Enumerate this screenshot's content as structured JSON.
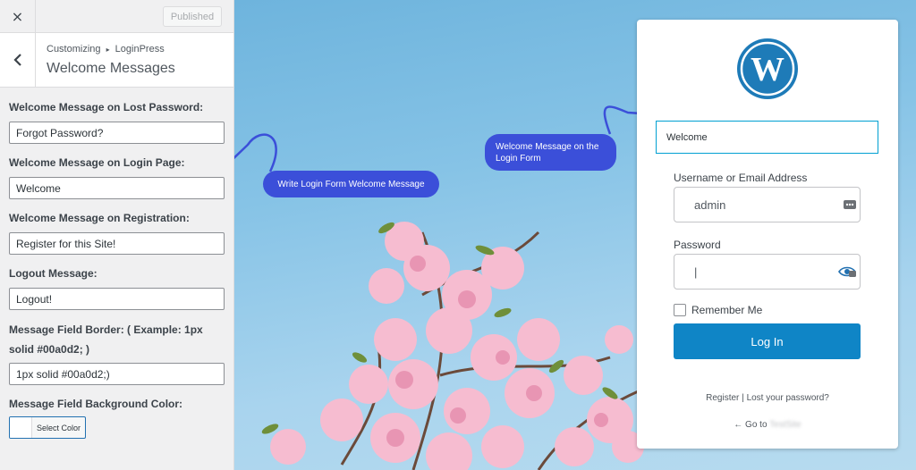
{
  "topbar": {
    "close_icon": "×",
    "publish_label": "Published"
  },
  "section": {
    "breadcrumb_root": "Customizing",
    "breadcrumb_sep": "▸",
    "breadcrumb_child": "LoginPress",
    "title": "Welcome Messages"
  },
  "controls": [
    {
      "label": "Welcome Message on Lost Password:",
      "value": "Forgot Password?"
    },
    {
      "label": "Welcome Message on Login Page:",
      "value": "Welcome"
    },
    {
      "label": "Welcome Message on Registration:",
      "value": "Register for this Site!"
    },
    {
      "label": "Logout Message:",
      "value": "Logout!"
    },
    {
      "label": "Message Field Border: ( Example: 1px solid #00a0d2; )",
      "value": "1px solid #00a0d2;)"
    }
  ],
  "bg_color": {
    "label": "Message Field Background Color:",
    "button": "Select Color"
  },
  "callouts": {
    "left": "Write Login Form Welcome Message",
    "right": "Welcome Message on the Login Form"
  },
  "login": {
    "welcome": "Welcome",
    "username_label": "Username or Email Address",
    "username_value": "admin",
    "password_label": "Password",
    "password_value": "|",
    "remember_label": "Remember Me",
    "login_button": "Log In",
    "register_link": "Register",
    "link_sep": "|",
    "lost_password_link": "Lost your password?",
    "goto_prefix": "← Go to",
    "site_name": "TestSite"
  },
  "colors": {
    "accent": "#0f85c6",
    "callout": "#3b4fd9",
    "field_border": "#00a0d2",
    "wordpress_logo": "#1e7bb8"
  },
  "icons": [
    "close-icon",
    "chevron-left-icon",
    "wordpress-logo-icon",
    "password-manager-icon",
    "show-password-icon",
    "arrow-icon"
  ]
}
